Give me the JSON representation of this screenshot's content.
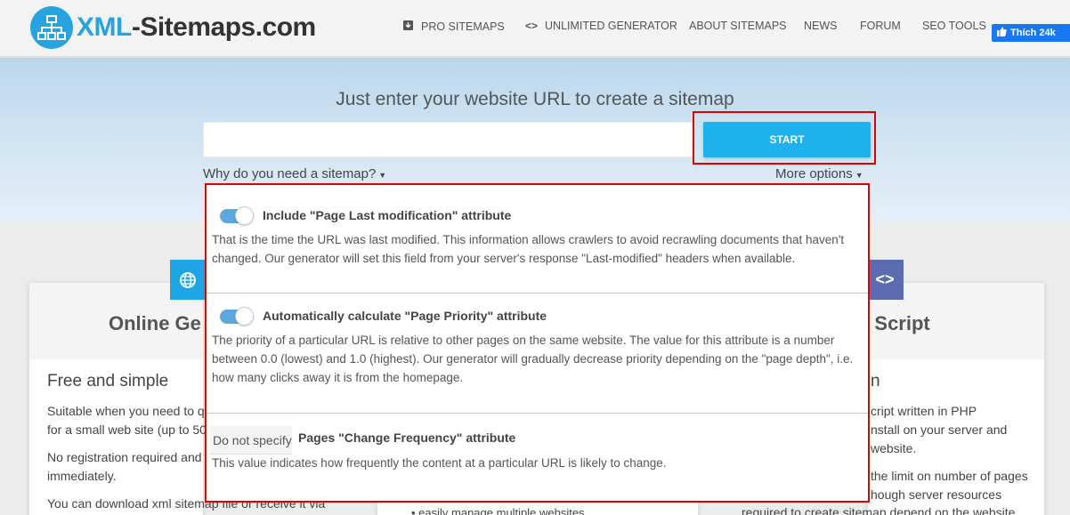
{
  "header": {
    "logo": {
      "prefix": "XML",
      "suffix": "-Sitemaps.com"
    },
    "nav": [
      {
        "label": "PRO SITEMAPS",
        "icon": "download-box-icon"
      },
      {
        "label": "UNLIMITED GENERATOR",
        "icon": "code-icon"
      },
      {
        "label": "ABOUT SITEMAPS"
      },
      {
        "label": "NEWS"
      },
      {
        "label": "FORUM"
      },
      {
        "label": "SEO TOOLS"
      }
    ],
    "facebook_like": "Thích 24k"
  },
  "hero": {
    "title": "Just enter your website URL to create a sitemap",
    "url_value": "",
    "start_label": "START",
    "why_link": "Why do you need a sitemap?",
    "more_options": "More options"
  },
  "options": {
    "lastmod": {
      "enabled": true,
      "label": "Include \"Page Last modification\" attribute",
      "description": "That is the time the URL was last modified. This information allows crawlers to avoid recrawling documents that haven't changed. Our generator will set this field from your server's response \"Last-modified\" headers when available."
    },
    "priority": {
      "enabled": true,
      "label": "Automatically calculate \"Page Priority\" attribute",
      "description": "The priority of a particular URL is relative to other pages on the same website. The value for this attribute is a number between 0.0 (lowest) and 1.0 (highest). Our generator will gradually decrease priority depending on the \"page depth\", i.e. how many clicks away it is from the homepage."
    },
    "changefreq": {
      "selected": "Do not specify",
      "label": "Pages \"Change Frequency\" attribute",
      "description": "This value indicates how frequently the content at a particular URL is likely to change."
    }
  },
  "cards": {
    "left": {
      "title_partial": "Online Ge",
      "subtitle": "Free and simple",
      "lines": [
        "Suitable when you need to qu",
        "for a small web site (up to 50",
        "No registration required and y",
        "immediately.",
        "You can download xml sitemap file or receive it via"
      ]
    },
    "right": {
      "title_partial": "P Script",
      "subtitle_partial": "n",
      "lines": [
        "cript written in PHP",
        "nstall on your server and",
        "website.",
        "the limit on number of pages",
        "hough server resources",
        "required to create sitemap depend on the website"
      ]
    },
    "middle": {
      "line": "easily manage multiple websites"
    }
  },
  "colors": {
    "accent": "#1eb3ef",
    "highlight": "#e00000",
    "toggle": "#5aa8de"
  }
}
